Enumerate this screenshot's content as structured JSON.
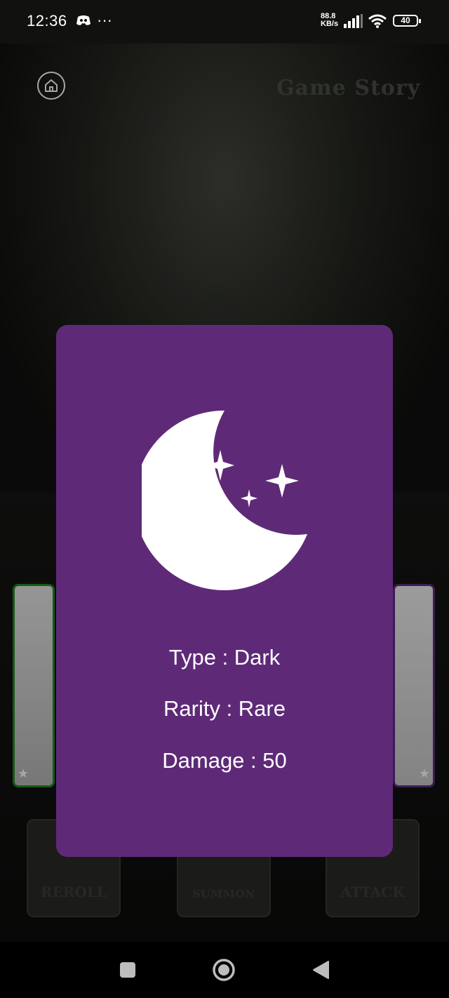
{
  "status_bar": {
    "time": "12:36",
    "more": "···",
    "net_speed_value": "88.8",
    "net_speed_unit": "KB/s",
    "battery": "40"
  },
  "header": {
    "title": "Game Story"
  },
  "modal": {
    "icon": "moon-stars-icon",
    "type_line": "Type : Dark",
    "rarity_line": "Rarity : Rare",
    "damage_line": "Damage : 50",
    "background_color": "#5e2a77"
  },
  "actions": {
    "reroll_label": "REROLL",
    "summon_label": "SUMMON",
    "attack_label": "ATTACK"
  },
  "nav": {
    "recent": "recent-apps-icon",
    "home": "home-circle-icon",
    "back": "back-triangle-icon"
  },
  "colors": {
    "left_card_border": "#1f8a1f",
    "right_card_border": "#5d2a80"
  }
}
